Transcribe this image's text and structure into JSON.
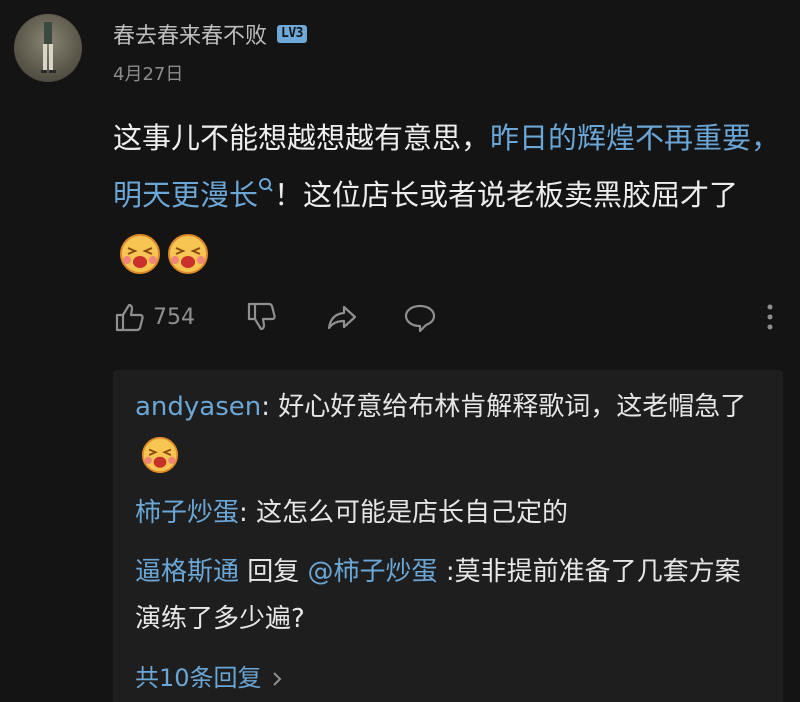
{
  "comment": {
    "username": "春去春来春不败",
    "level_badge": "LV3",
    "date": "4月27日",
    "text_before": "这事儿不能想越想越有意思，",
    "highlight": "昨日的辉煌不再重要，明天更漫长",
    "text_after": "！这位店长或者说老板卖黑胶屈才了",
    "like_count": "754",
    "icons": [
      "thumbs-up-icon",
      "thumbs-down-icon",
      "share-icon",
      "comment-icon",
      "more-icon"
    ]
  },
  "replies": [
    {
      "user": "andyasen",
      "separator": ": ",
      "text": "好心好意给布林肯解释歌词，这老帽急了",
      "emoji": true
    },
    {
      "user": "柿子炒蛋",
      "separator": ": ",
      "text": "这怎么可能是店长自己定的",
      "emoji": false
    },
    {
      "user": "逼格斯通",
      "reply_word": " 回复 ",
      "reply_to": "@柿子炒蛋",
      "text": " :莫非提前准备了几套方案演练了多少遍?",
      "emoji": false
    }
  ],
  "more_replies": "共10条回复",
  "colors": {
    "background": "#141414",
    "link": "#6aa6d6",
    "reply_bg": "#1e1e1e",
    "muted": "#8f8f8f"
  }
}
